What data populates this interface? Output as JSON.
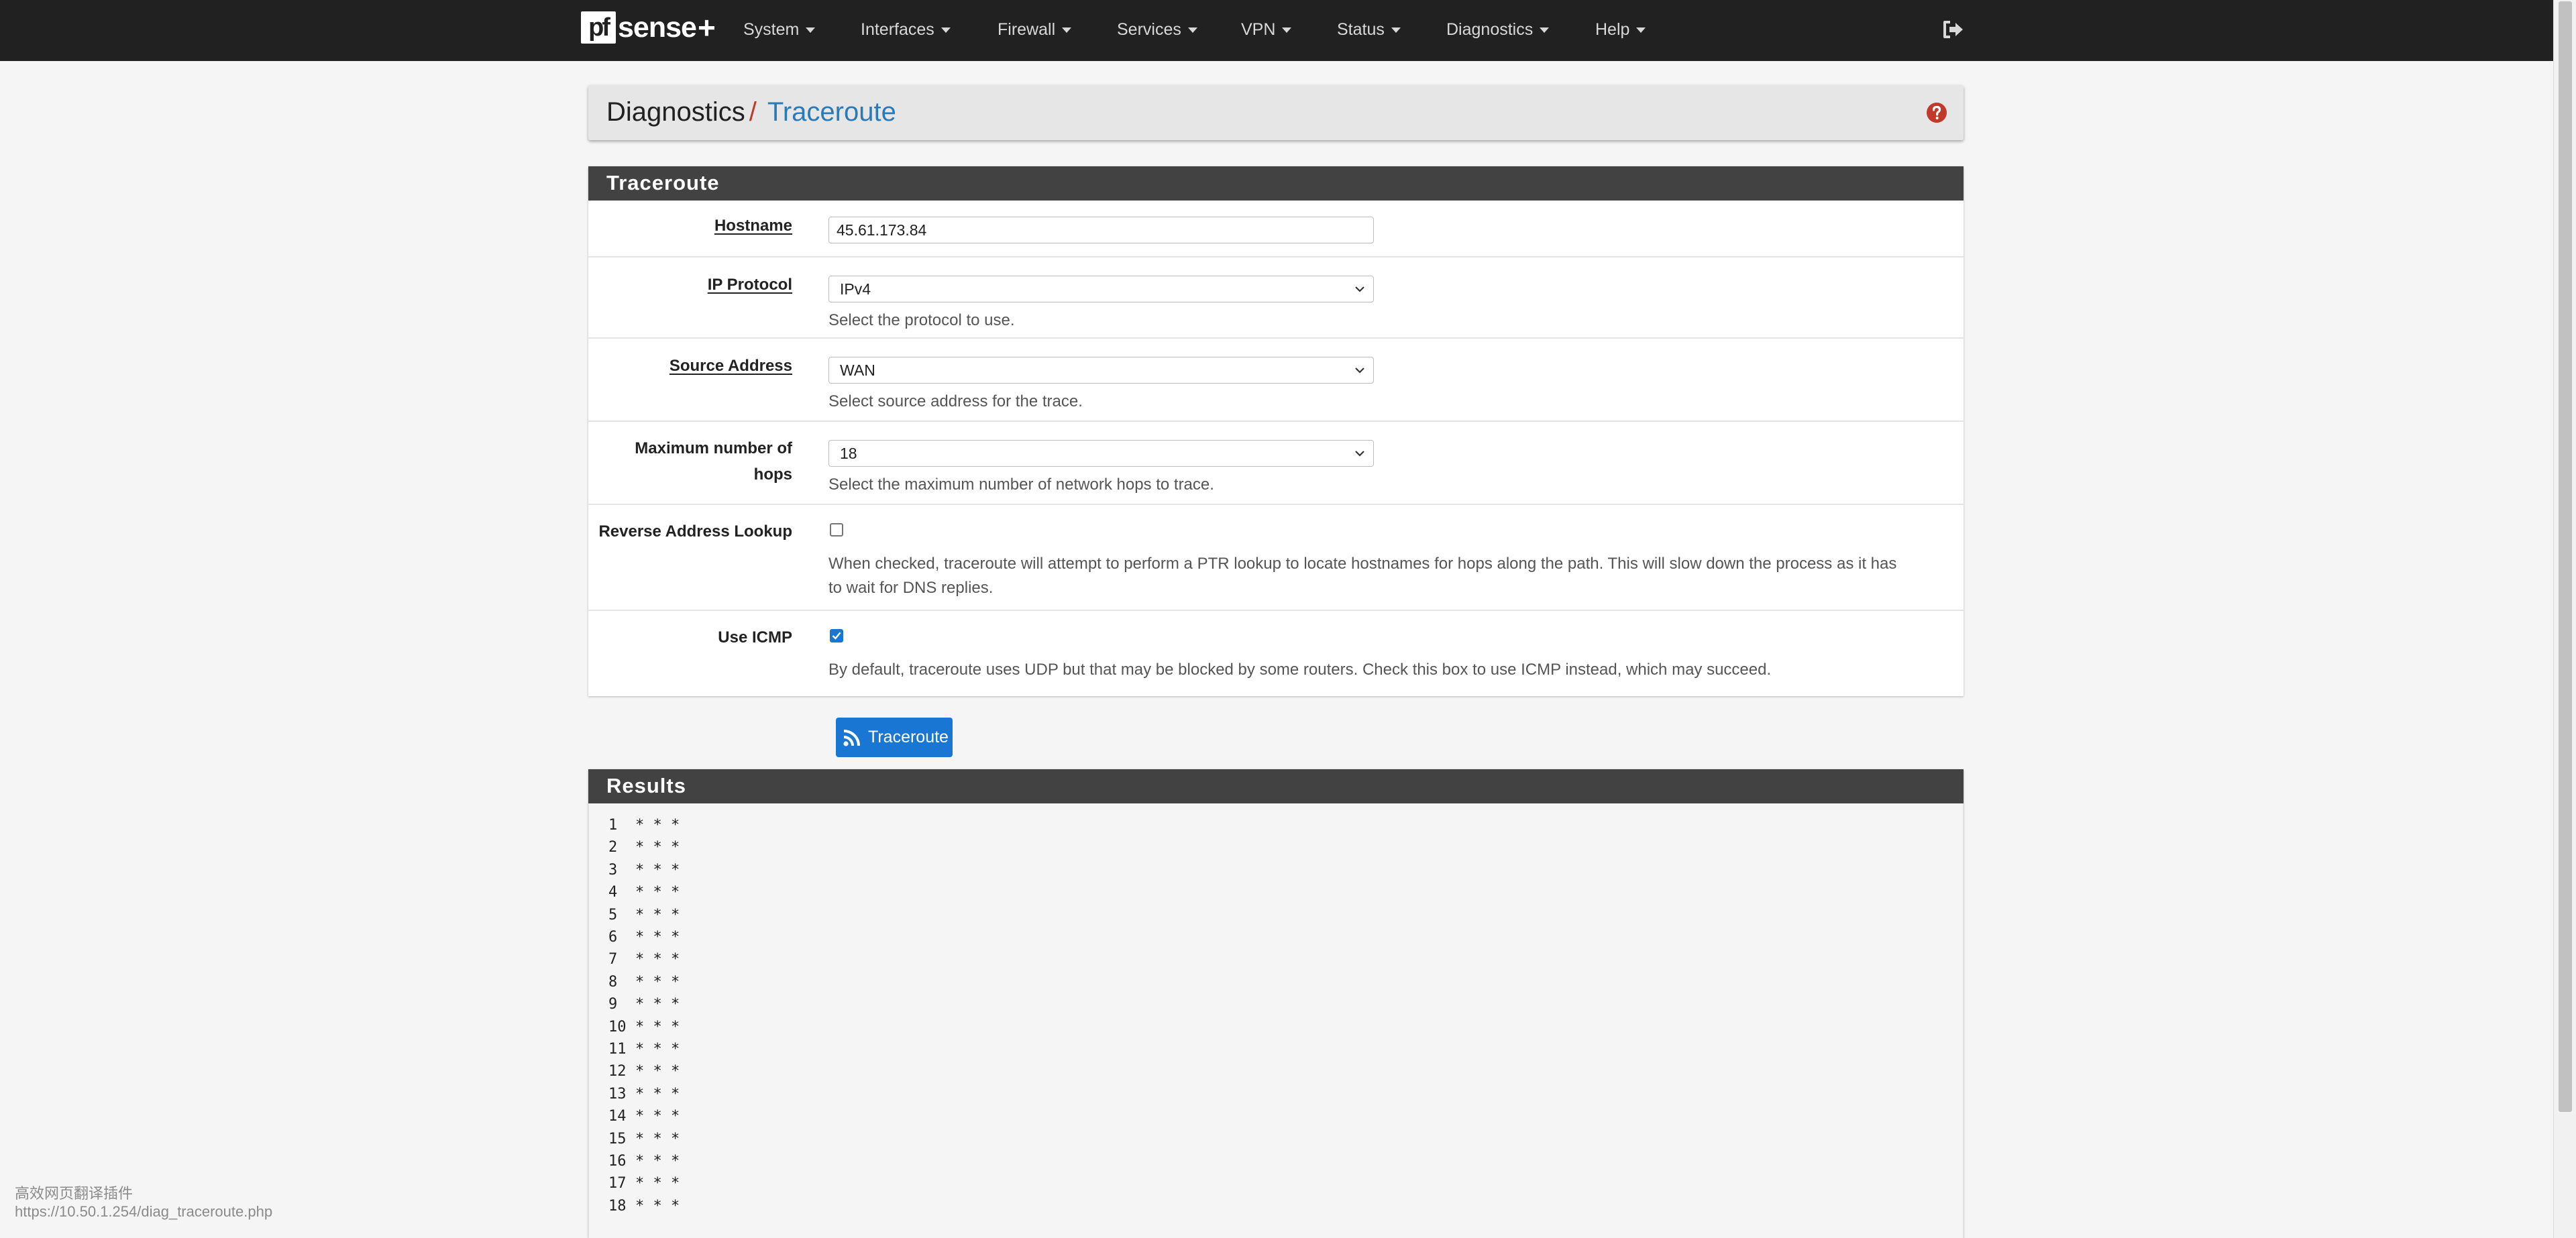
{
  "brand": {
    "pf": "pf",
    "sense": "sense",
    "plus": "+"
  },
  "nav": {
    "items": [
      {
        "label": "System"
      },
      {
        "label": "Interfaces"
      },
      {
        "label": "Firewall"
      },
      {
        "label": "Services"
      },
      {
        "label": "VPN"
      },
      {
        "label": "Status"
      },
      {
        "label": "Diagnostics"
      },
      {
        "label": "Help"
      }
    ],
    "logout_icon": "sign-out-icon"
  },
  "breadcrumb": {
    "section": "Diagnostics",
    "separator": "/",
    "page": "Traceroute",
    "help_icon": "question-circle-icon"
  },
  "form": {
    "title": "Traceroute",
    "hostname": {
      "label": "Hostname",
      "value": "45.61.173.84"
    },
    "ip_protocol": {
      "label": "IP Protocol",
      "value": "IPv4",
      "help": "Select the protocol to use."
    },
    "source_address": {
      "label": "Source Address",
      "value": "WAN",
      "help": "Select source address for the trace."
    },
    "max_hops": {
      "label_line1": "Maximum number of",
      "label_line2": "hops",
      "value": "18",
      "help": "Select the maximum number of network hops to trace."
    },
    "reverse_lookup": {
      "label": "Reverse Address Lookup",
      "checked": false,
      "help_line1": "When checked, traceroute will attempt to perform a PTR lookup to locate hostnames for hops along the path. This will slow down the process as it has",
      "help_line2": "to wait for DNS replies."
    },
    "use_icmp": {
      "label": "Use ICMP",
      "checked": true,
      "help": "By default, traceroute uses UDP but that may be blocked by some routers. Check this box to use ICMP instead, which may succeed."
    },
    "submit": {
      "label": "Traceroute",
      "icon": "rss-icon"
    }
  },
  "results": {
    "title": "Results",
    "lines": [
      {
        "hop": "1",
        "text": "* * *"
      },
      {
        "hop": "2",
        "text": "* * *"
      },
      {
        "hop": "3",
        "text": "* * *"
      },
      {
        "hop": "4",
        "text": "* * *"
      },
      {
        "hop": "5",
        "text": "* * *"
      },
      {
        "hop": "6",
        "text": "* * *"
      },
      {
        "hop": "7",
        "text": "* * *"
      },
      {
        "hop": "8",
        "text": "* * *"
      },
      {
        "hop": "9",
        "text": "* * *"
      },
      {
        "hop": "10",
        "text": "* * *"
      },
      {
        "hop": "11",
        "text": "* * *"
      },
      {
        "hop": "12",
        "text": "* * *"
      },
      {
        "hop": "13",
        "text": "* * *"
      },
      {
        "hop": "14",
        "text": "* * *"
      },
      {
        "hop": "15",
        "text": "* * *"
      },
      {
        "hop": "16",
        "text": "* * *"
      },
      {
        "hop": "17",
        "text": "* * *"
      },
      {
        "hop": "18",
        "text": "* * *"
      }
    ]
  },
  "statusbar": {
    "line1": "高效网页翻译插件",
    "url": "https://10.50.1.254/diag_traceroute.php"
  },
  "colors": {
    "navbar": "#212121",
    "panel_heading": "#424242",
    "primary": "#1976d2",
    "link": "#2a7ab8",
    "help_red": "#c0392b"
  }
}
